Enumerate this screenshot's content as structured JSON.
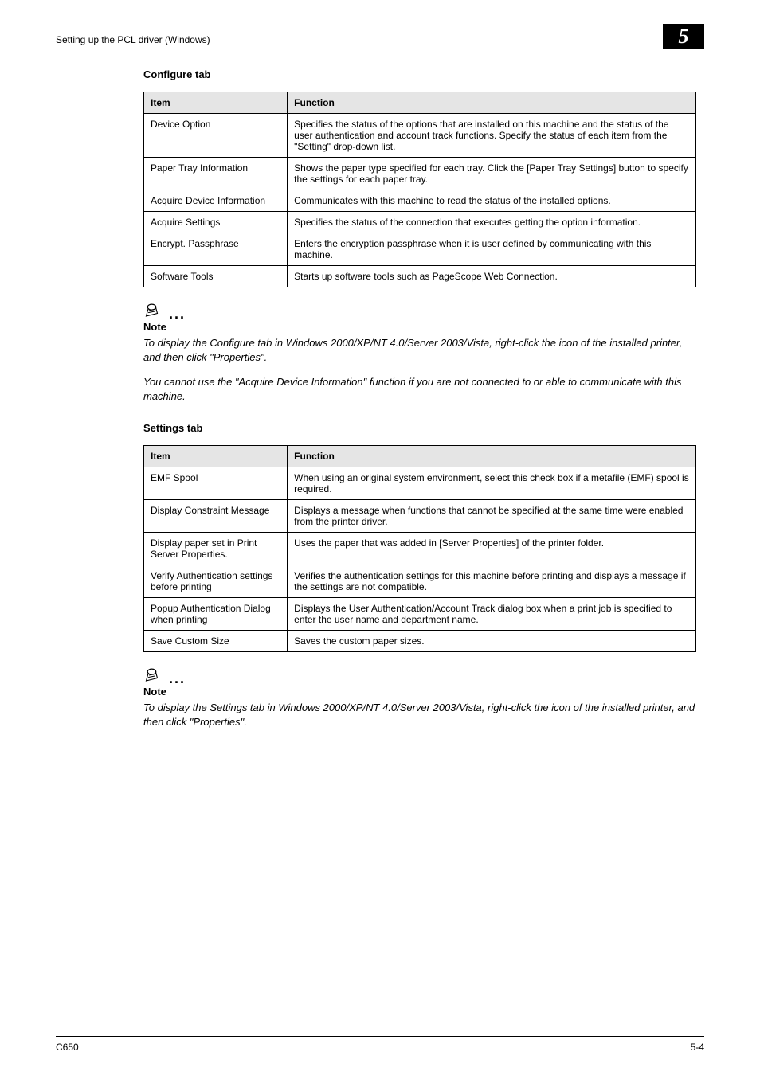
{
  "header": {
    "running_head": "Setting up the PCL driver (Windows)",
    "chapter_number": "5"
  },
  "section1": {
    "title": "Configure tab",
    "columns": {
      "item": "Item",
      "function": "Function"
    },
    "rows": [
      {
        "item": "Device Option",
        "function": "Specifies the status of the options that are installed on this machine and the status of the user authentication and account track functions. Specify the status of each item from the \"Setting\" drop-down list."
      },
      {
        "item": "Paper Tray Information",
        "function": "Shows the paper type specified for each tray. Click the [Paper Tray Settings] button to specify the settings for each paper tray."
      },
      {
        "item": "Acquire Device Information",
        "function": "Communicates with this machine to read the status of the installed options."
      },
      {
        "item": "Acquire Settings",
        "function": "Specifies the status of the connection that executes getting the option information."
      },
      {
        "item": "Encrypt. Passphrase",
        "function": "Enters the encryption passphrase when it is user defined by communicating with this machine."
      },
      {
        "item": "Software Tools",
        "function": "Starts up software tools such as PageScope Web Connection."
      }
    ]
  },
  "note1": {
    "label": "Note",
    "p1": "To display the Configure tab in Windows 2000/XP/NT 4.0/Server 2003/Vista, right-click the icon of the installed printer, and then click \"Properties\".",
    "p2": "You cannot use the \"Acquire Device Information\" function if you are not connected to or able to communicate with this machine."
  },
  "section2": {
    "title": "Settings tab",
    "columns": {
      "item": "Item",
      "function": "Function"
    },
    "rows": [
      {
        "item": "EMF Spool",
        "function": "When using an original system environment, select this check box if a metafile (EMF) spool is required."
      },
      {
        "item": "Display Constraint Message",
        "function": "Displays a message when functions that cannot be specified at the same time were enabled from the printer driver."
      },
      {
        "item": "Display paper set in Print Server Properties.",
        "function": "Uses the paper that was added in [Server Properties] of the printer folder."
      },
      {
        "item": "Verify Authentication settings before printing",
        "function": "Verifies the authentication settings for this machine before printing and displays a message if the settings are not compatible."
      },
      {
        "item": "Popup Authentication Dialog when printing",
        "function": "Displays the User Authentication/Account Track dialog box when a print job is specified to enter the user name and department name."
      },
      {
        "item": "Save Custom Size",
        "function": "Saves the custom paper sizes."
      }
    ]
  },
  "note2": {
    "label": "Note",
    "p1": "To display the Settings tab in Windows 2000/XP/NT 4.0/Server 2003/Vista, right-click the icon of the installed printer, and then click \"Properties\"."
  },
  "footer": {
    "left": "C650",
    "right": "5-4"
  }
}
